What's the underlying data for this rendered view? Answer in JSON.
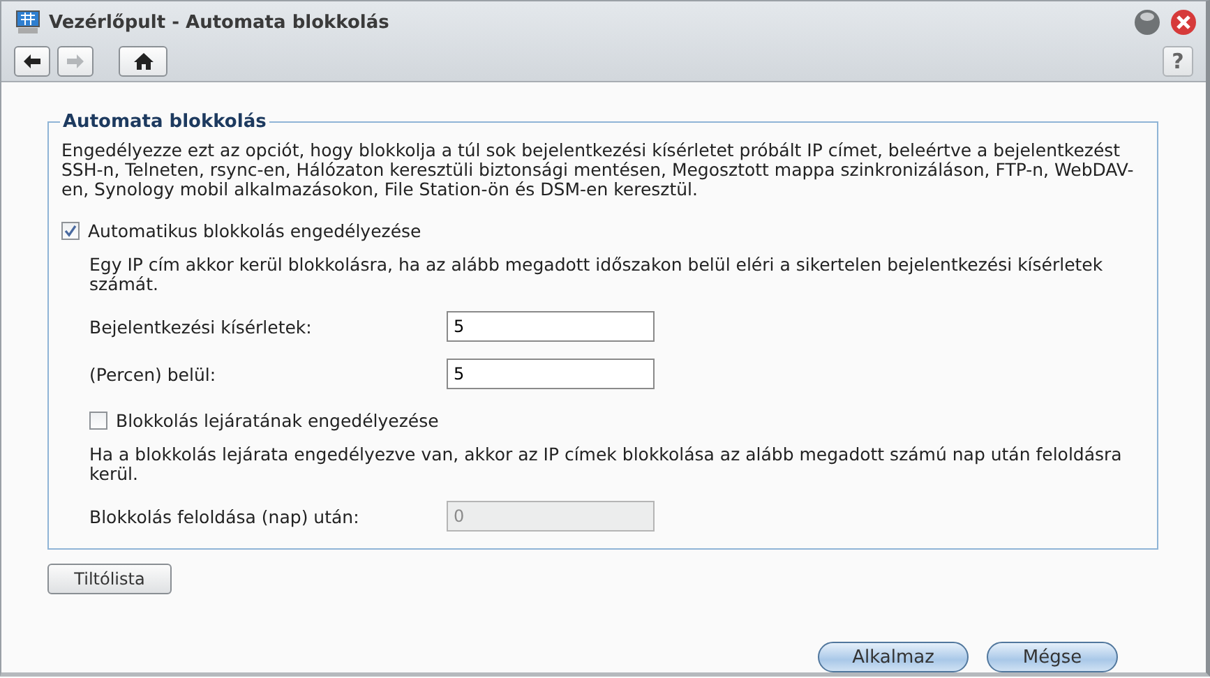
{
  "window": {
    "title": "Vezérlőpult - Automata blokkolás"
  },
  "toolbar": {
    "back": {
      "disabled": false
    },
    "forward": {
      "disabled": true
    },
    "help_label": "?"
  },
  "section": {
    "legend": "Automata blokkolás",
    "description": "Engedélyezze ezt az opciót, hogy blokkolja a túl sok bejelentkezési kísérletet próbált IP címet, beleértve a bejelentkezést SSH-n, Telneten, rsync-en, Hálózaton keresztüli biztonsági mentésen, Megosztott mappa szinkronizáláson, FTP-n, WebDAV-en, Synology mobil alkalmazásokon, File Station-ön és DSM-en keresztül.",
    "items": [
      {
        "kind": "checkbox",
        "label": "Automatikus blokkolás engedélyezése",
        "checked": true,
        "children": [
          {
            "kind": "note",
            "text": "Egy IP cím akkor kerül blokkolásra, ha az alább megadott időszakon belül eléri a sikertelen bejelentkezési kísérletek számát."
          },
          {
            "kind": "field",
            "label": "Bejelentkezési kísérletek:",
            "value": "5",
            "disabled": false
          },
          {
            "kind": "field",
            "label": "(Percen) belül:",
            "value": "5",
            "disabled": false
          },
          {
            "kind": "checkbox",
            "label": "Blokkolás lejáratának engedélyezése",
            "checked": false
          },
          {
            "kind": "note",
            "text": "Ha a blokkolás lejárata engedélyezve van, akkor az IP címek blokkolása az alább megadott számú nap után feloldásra kerül."
          },
          {
            "kind": "field",
            "label": "Blokkolás feloldása (nap) után:",
            "value": "0",
            "disabled": true
          }
        ]
      }
    ]
  },
  "blocklist_button": "Tiltólista",
  "footer_buttons": [
    "Alkalmaz",
    "Mégse"
  ]
}
